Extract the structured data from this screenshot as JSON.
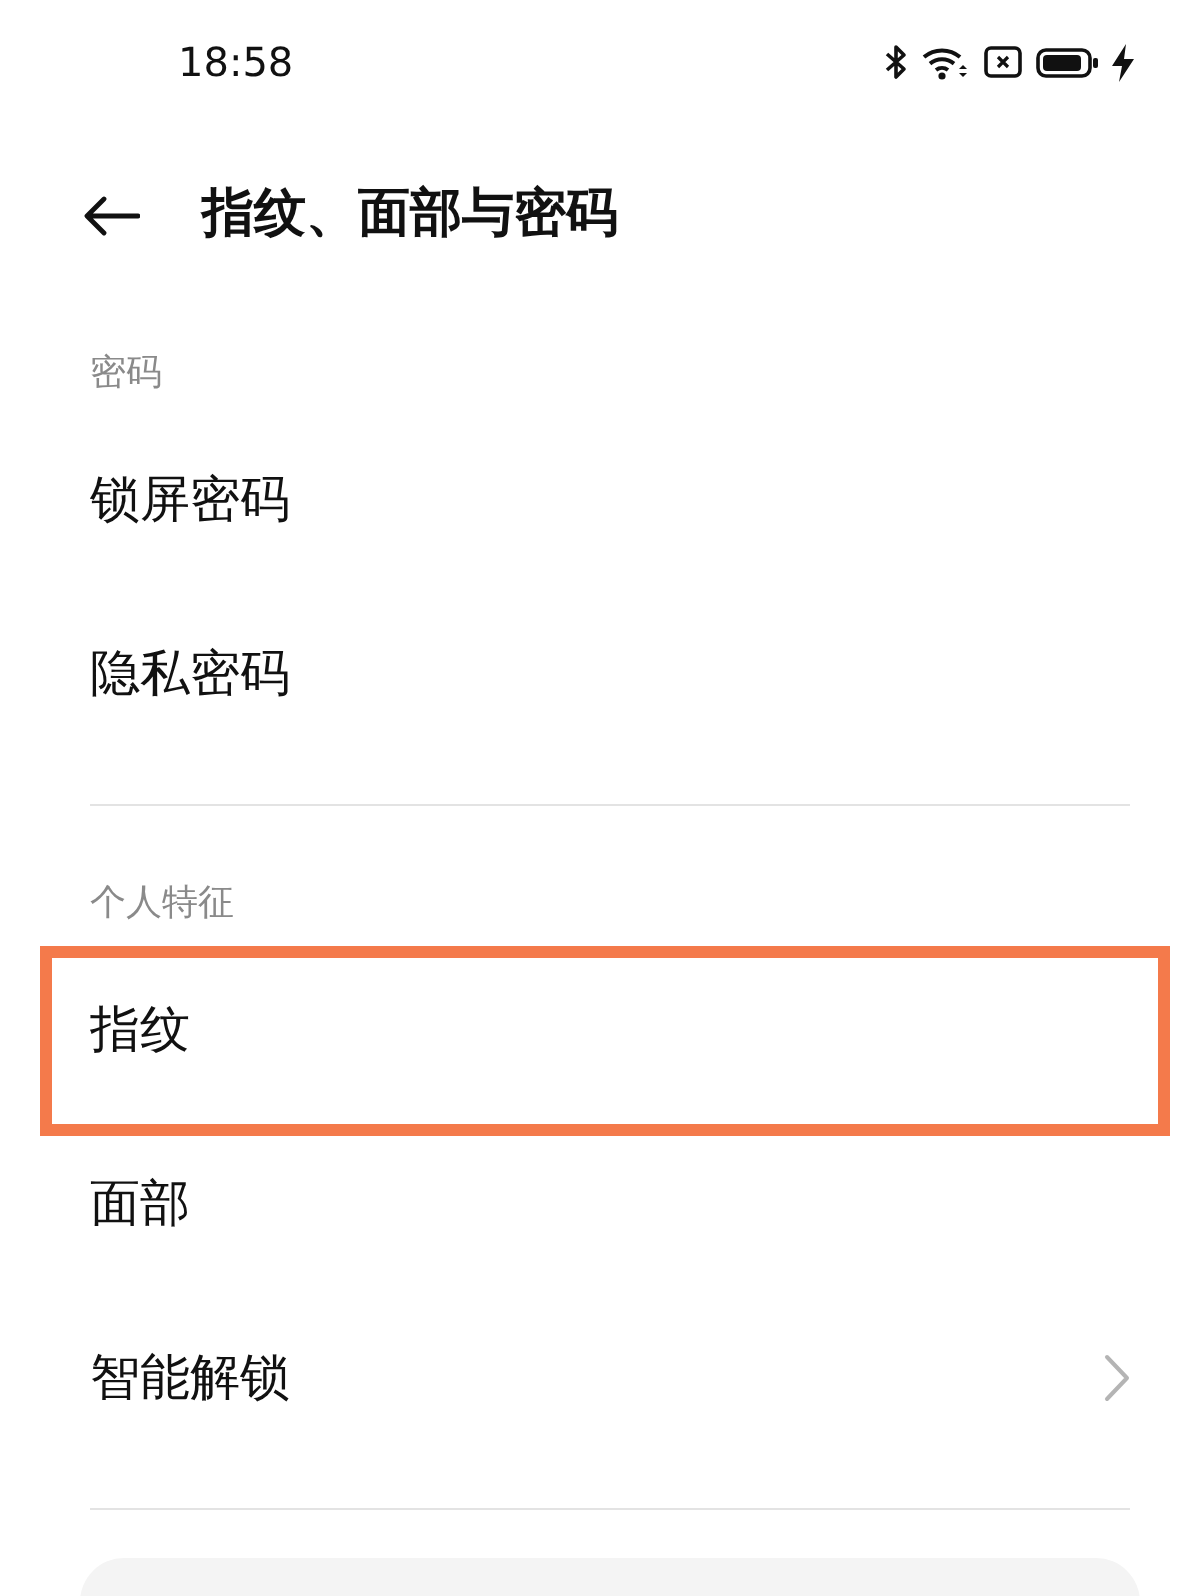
{
  "status_bar": {
    "time": "18:58"
  },
  "header": {
    "title": "指纹、面部与密码"
  },
  "sections": [
    {
      "label": "密码",
      "items": [
        {
          "label": "锁屏密码",
          "highlighted": false,
          "chevron": false
        },
        {
          "label": "隐私密码",
          "highlighted": false,
          "chevron": false
        }
      ]
    },
    {
      "label": "个人特征",
      "items": [
        {
          "label": "指纹",
          "highlighted": true,
          "chevron": false
        },
        {
          "label": "面部",
          "highlighted": false,
          "chevron": false
        },
        {
          "label": "智能解锁",
          "highlighted": false,
          "chevron": true
        }
      ]
    }
  ]
}
